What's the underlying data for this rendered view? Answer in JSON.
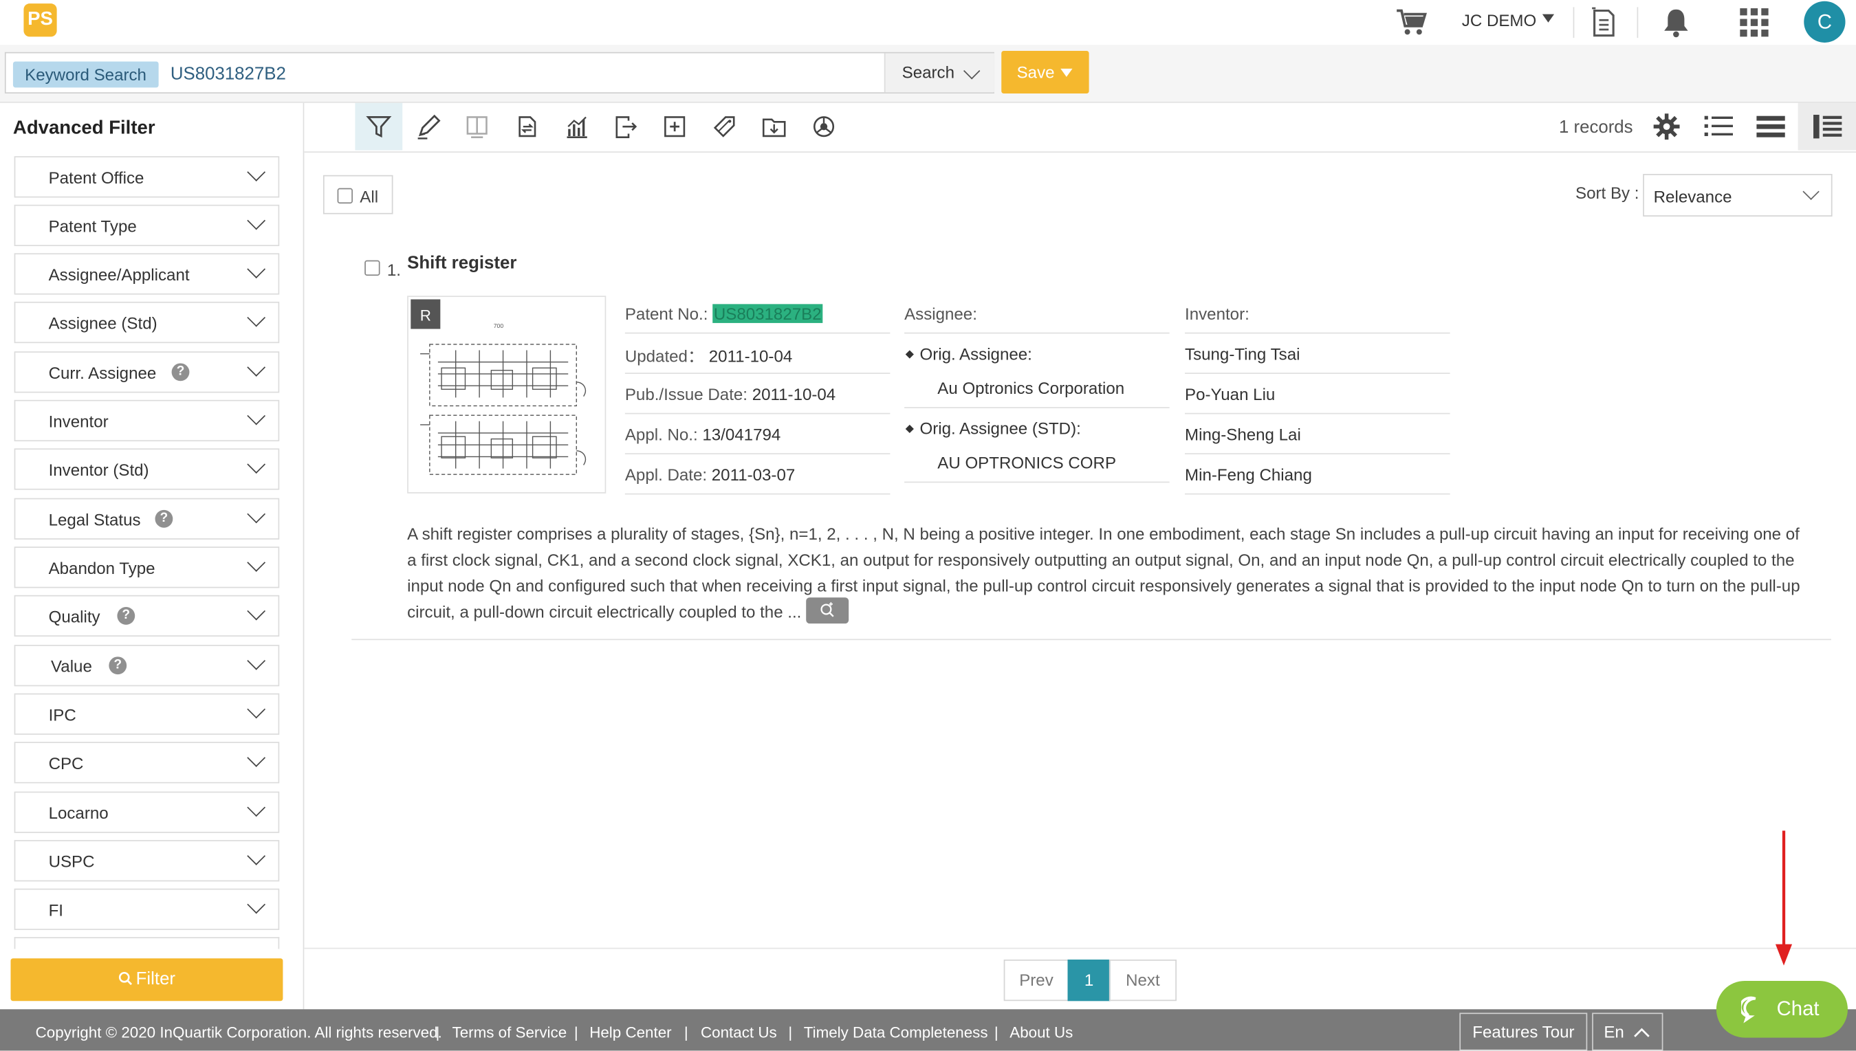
{
  "topbar": {
    "logo_text": "PS",
    "user_name": "JC DEMO",
    "avatar_initial": "C",
    "icons": [
      "cart-icon",
      "report-icon",
      "bell-icon",
      "apps-grid-icon"
    ]
  },
  "search": {
    "tag": "Keyword Search",
    "value": "US8031827B2",
    "search_label": "Search",
    "save_label": "Save"
  },
  "sidebar": {
    "title": "Advanced Filter",
    "filters": [
      {
        "label": "Patent Office",
        "help": false
      },
      {
        "label": "Patent Type",
        "help": false
      },
      {
        "label": "Assignee/Applicant",
        "help": false
      },
      {
        "label": "Assignee (Std)",
        "help": false
      },
      {
        "label": "Curr. Assignee",
        "help": true
      },
      {
        "label": "Inventor",
        "help": false
      },
      {
        "label": "Inventor (Std)",
        "help": false
      },
      {
        "label": "Legal Status",
        "help": true
      },
      {
        "label": "Abandon Type",
        "help": false
      },
      {
        "label": "Quality",
        "help": true
      },
      {
        "label": "Value",
        "help": true
      },
      {
        "label": "IPC",
        "help": false
      },
      {
        "label": "CPC",
        "help": false
      },
      {
        "label": "Locarno",
        "help": false
      },
      {
        "label": "USPC",
        "help": false
      },
      {
        "label": "FI",
        "help": false
      }
    ],
    "help_glyph": "?",
    "filter_button": "Filter"
  },
  "toolbar": {
    "records": "1 records",
    "icons": [
      "filter-icon",
      "highlight-pen-icon",
      "compare-icon",
      "transfer-icon",
      "chart-icon",
      "export-icon",
      "add-icon",
      "tag-icon",
      "folder-save-icon",
      "share-icon"
    ],
    "view_icons": [
      "settings-gear-icon",
      "list-view-icon",
      "compact-view-icon",
      "detail-view-icon"
    ]
  },
  "results_header": {
    "all_label": "All",
    "sort_label": "Sort By :",
    "sort_value": "Relevance"
  },
  "result": {
    "index": "1.",
    "title": "Shift register",
    "badge": "R",
    "patent_no_label": "Patent No.:",
    "patent_no": "US8031827B2",
    "updated_label": "Updated：",
    "updated": "2011-10-04",
    "pub_label": "Pub./Issue Date:",
    "pub_date": "2011-10-04",
    "appl_no_label": "Appl. No.:",
    "appl_no": "13/041794",
    "appl_date_label": "Appl. Date:",
    "appl_date": "2011-03-07",
    "assignee_label": "Assignee:",
    "orig_assignee_label": "Orig. Assignee:",
    "orig_assignee": "Au Optronics Corporation",
    "orig_assignee_std_label": "Orig. Assignee (STD):",
    "orig_assignee_std": "AU OPTRONICS CORP",
    "inventor_label": "Inventor:",
    "inventors": [
      "Tsung-Ting Tsai",
      "Po-Yuan Liu",
      "Ming-Sheng Lai",
      "Min-Feng Chiang"
    ],
    "abstract": "A shift register comprises a plurality of stages, {Sn}, n=1, 2, . . . , N, N being a positive integer. In one embodiment, each stage Sn includes a pull-up circuit having an input for receiving one of a first clock signal, CK1, and a second clock signal, XCK1, an output for responsively outputting an output signal, On, and an input node Qn, a pull-up control circuit electrically coupled to the input node Qn and configured such that when receiving a first input signal, the pull-up control circuit responsively generates a signal that is provided to the input node Qn to turn on the pull-up circuit, a pull-down circuit electrically coupled to the ..."
  },
  "pagination": {
    "prev": "Prev",
    "current": "1",
    "next": "Next"
  },
  "footer": {
    "copyright": "Copyright © 2020 InQuartik Corporation. All rights reserved.",
    "links": [
      "Terms of Service",
      "Help Center",
      "Contact Us",
      "Timely Data Completeness",
      "About Us"
    ],
    "separator": "|",
    "features_tour": "Features Tour",
    "language": "En",
    "chat": "Chat"
  },
  "colors": {
    "accent_yellow": "#f5b82e",
    "accent_teal": "#2a95a7",
    "chat_green": "#8cc63f",
    "highlight_green": "#2bb180",
    "footer_gray": "#7a7a7a"
  }
}
